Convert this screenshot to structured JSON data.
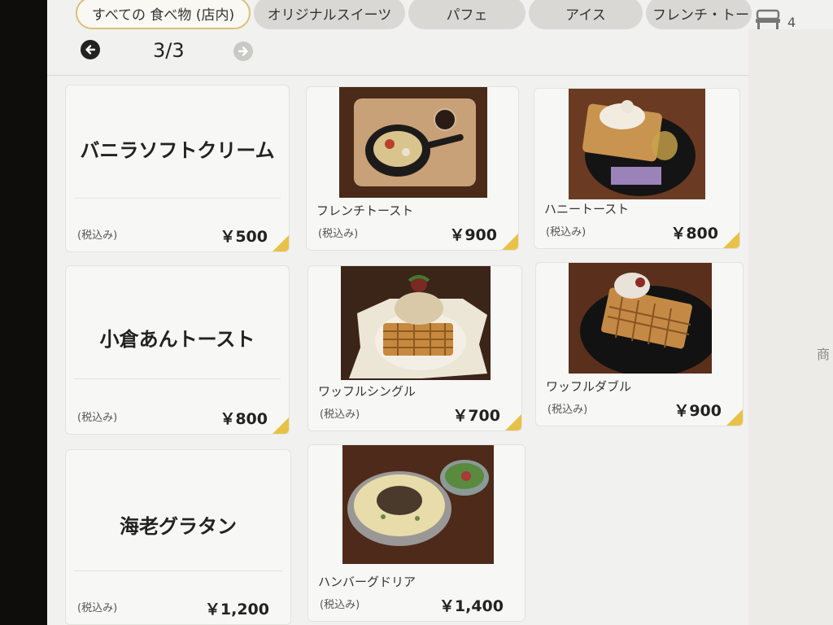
{
  "tabs": [
    {
      "label": "すべての 食べ物 (店内)",
      "active": true
    },
    {
      "label": "オリジナルスイーツ",
      "active": false
    },
    {
      "label": "パフェ",
      "active": false
    },
    {
      "label": "アイス",
      "active": false
    },
    {
      "label": "フレンチ・トー",
      "active": false
    }
  ],
  "cart": {
    "icon": "seat-icon",
    "count": "4"
  },
  "pager": {
    "current": "3/3",
    "prev_icon": "arrow-left-icon",
    "next_icon": "arrow-right-icon"
  },
  "side_text": "商",
  "colors": {
    "accent": "#e8c248",
    "active_tab_border": "#d9bf78",
    "background": "#f1f1ef"
  },
  "items": [
    {
      "name": "バニラソフトクリーム",
      "tax_label": "(税込み)",
      "price": "￥500",
      "has_photo": false
    },
    {
      "name": "フレンチトースト",
      "tax_label": "(税込み)",
      "price": "￥900",
      "has_photo": true
    },
    {
      "name": "ハニートースト",
      "tax_label": "(税込み)",
      "price": "￥800",
      "has_photo": true
    },
    {
      "name": "小倉あんトースト",
      "tax_label": "(税込み)",
      "price": "￥800",
      "has_photo": false
    },
    {
      "name": "ワッフルシングル",
      "tax_label": "(税込み)",
      "price": "￥700",
      "has_photo": true
    },
    {
      "name": "ワッフルダブル",
      "tax_label": "(税込み)",
      "price": "￥900",
      "has_photo": true
    },
    {
      "name": "海老グラタン",
      "tax_label": "(税込み)",
      "price": "￥1,200",
      "has_photo": false
    },
    {
      "name": "ハンバーグドリア",
      "tax_label": "(税込み)",
      "price": "￥1,400",
      "has_photo": true
    }
  ]
}
